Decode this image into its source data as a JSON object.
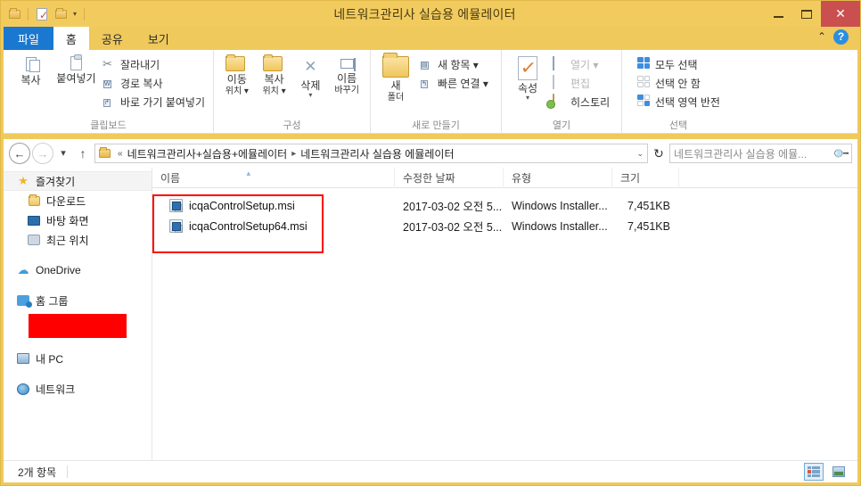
{
  "window": {
    "title": "네트워크관리사 실습용 에뮬레이터",
    "minimize_label": "최소화",
    "maximize_label": "최대화",
    "close_label": "✕"
  },
  "quick_access": {
    "folder_label": "폴더",
    "properties_label": "속성",
    "new_folder_label": "새 폴더",
    "customize_caret": "▾"
  },
  "tabs": [
    {
      "label": "파일",
      "kind": "file"
    },
    {
      "label": "홈",
      "kind": "active"
    },
    {
      "label": "공유",
      "kind": "normal"
    },
    {
      "label": "보기",
      "kind": "normal"
    }
  ],
  "ribbon_controls": {
    "collapse_label": "⌃",
    "help_label": "?"
  },
  "ribbon": {
    "groups": [
      {
        "title": "클립보드",
        "big_buttons": [
          {
            "label_top": "복사",
            "label_bottom": "",
            "icon": "copy-icon"
          },
          {
            "label_top": "붙여넣기",
            "label_bottom": "",
            "icon": "paste-icon"
          }
        ],
        "small_buttons": [
          {
            "label": "잘라내기",
            "icon": "scissors-icon",
            "dim": false
          },
          {
            "label": "경로 복사",
            "icon": "copy-path-icon",
            "dim": false
          },
          {
            "label": "바로 가기 붙여넣기",
            "icon": "paste-shortcut-icon",
            "dim": false
          }
        ]
      },
      {
        "title": "구성",
        "big_buttons": [
          {
            "label_top": "이동",
            "label_bottom": "위치 ▾",
            "icon": "move-to-icon"
          },
          {
            "label_top": "복사",
            "label_bottom": "위치 ▾",
            "icon": "copy-to-icon"
          },
          {
            "label_top": "삭제",
            "label_bottom": "▾",
            "icon": "delete-icon"
          },
          {
            "label_top": "이름",
            "label_bottom": "바꾸기",
            "icon": "rename-icon"
          }
        ],
        "small_buttons": []
      },
      {
        "title": "새로 만들기",
        "big_buttons": [
          {
            "label_top": "새",
            "label_bottom": "폴더",
            "icon": "new-folder-icon"
          }
        ],
        "small_buttons": [
          {
            "label": "새 항목 ▾",
            "icon": "new-item-icon",
            "dim": false
          },
          {
            "label": "빠른 연결 ▾",
            "icon": "easy-access-icon",
            "dim": false
          }
        ]
      },
      {
        "title": "열기",
        "big_buttons": [
          {
            "label_top": "속성",
            "label_bottom": "▾",
            "icon": "properties-icon"
          }
        ],
        "small_buttons": [
          {
            "label": "열기 ▾",
            "icon": "open-icon",
            "dim": true
          },
          {
            "label": "편집",
            "icon": "edit-icon",
            "dim": true
          },
          {
            "label": "히스토리",
            "icon": "history-icon",
            "dim": false
          }
        ]
      },
      {
        "title": "선택",
        "big_buttons": [],
        "small_buttons": [
          {
            "label": "모두 선택",
            "icon": "select-all-icon",
            "dim": false
          },
          {
            "label": "선택 안 함",
            "icon": "select-none-icon",
            "dim": false
          },
          {
            "label": "선택 영역 반전",
            "icon": "invert-selection-icon",
            "dim": false
          }
        ]
      }
    ]
  },
  "address": {
    "back_label": "←",
    "forward_label": "→",
    "history_label": "▾",
    "up_label": "↑",
    "crumbs": [
      {
        "text": "«",
        "type": "overflow"
      },
      {
        "text": "네트워크관리사+실습용+에뮬레이터",
        "type": "crumb"
      },
      {
        "text": "▸",
        "type": "separator"
      },
      {
        "text": "네트워크관리사 실습용 에뮬레이터",
        "type": "crumb"
      }
    ],
    "dropdown_caret": "⌄",
    "refresh_label": "↻",
    "search_placeholder": "네트워크관리사 실습용 에뮬...",
    "search_value": "",
    "search_icon": "🔍"
  },
  "nav_pane": {
    "items": [
      {
        "label": "즐겨찾기",
        "icon": "star-icon",
        "level": "header"
      },
      {
        "label": "다운로드",
        "icon": "downloads-folder-icon",
        "level": "child"
      },
      {
        "label": "바탕 화면",
        "icon": "desktop-icon",
        "level": "child"
      },
      {
        "label": "최근 위치",
        "icon": "recent-places-icon",
        "level": "child"
      },
      {
        "label": "OneDrive",
        "icon": "onedrive-icon",
        "level": "root"
      },
      {
        "label": "홈 그룹",
        "icon": "homegroup-icon",
        "level": "root"
      },
      {
        "label": "",
        "icon": "redaction-box",
        "level": "redacted"
      },
      {
        "label": "내 PC",
        "icon": "this-pc-icon",
        "level": "root"
      },
      {
        "label": "네트워크",
        "icon": "network-icon",
        "level": "root"
      }
    ]
  },
  "file_list": {
    "columns": [
      {
        "label": "이름",
        "key": "name",
        "sorted": true
      },
      {
        "label": "수정한 날짜",
        "key": "date",
        "sorted": false
      },
      {
        "label": "유형",
        "key": "type",
        "sorted": false
      },
      {
        "label": "크기",
        "key": "size",
        "sorted": false
      }
    ],
    "sort_arrow": "▴",
    "rows": [
      {
        "name": "icqaControlSetup.msi",
        "date": "2017-03-02 오전 5...",
        "type": "Windows Installer...",
        "size": "7,451KB",
        "icon": "msi-installer-icon"
      },
      {
        "name": "icqaControlSetup64.msi",
        "date": "2017-03-02 오전 5...",
        "type": "Windows Installer...",
        "size": "7,451KB",
        "icon": "msi-installer-icon"
      }
    ],
    "annotation": {
      "shape": "rectangle",
      "color": "#ff0000"
    }
  },
  "status_bar": {
    "item_count_text": "2개 항목",
    "details_view_label": "자세히",
    "tiles_view_label": "큰 아이콘"
  },
  "colors": {
    "window_frame": "#f2cb5f",
    "file_tab": "#1b78d0",
    "close_button": "#c9504e",
    "annotation": "#ff0000",
    "help_button": "#2b8fe0"
  }
}
